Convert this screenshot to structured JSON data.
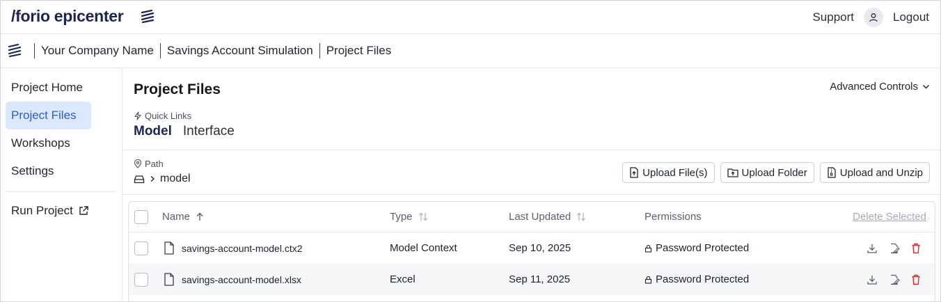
{
  "header": {
    "logo_slash": "/",
    "logo_forio": "forio",
    "logo_epicenter": "epicenter",
    "support": "Support",
    "logout": "Logout"
  },
  "breadcrumb": {
    "items": [
      "Your Company Name",
      "Savings Account Simulation",
      "Project Files"
    ]
  },
  "sidebar": {
    "items": [
      {
        "label": "Project Home",
        "active": false
      },
      {
        "label": "Project Files",
        "active": true
      },
      {
        "label": "Workshops",
        "active": false
      },
      {
        "label": "Settings",
        "active": false
      }
    ],
    "run_project": "Run Project"
  },
  "main": {
    "title": "Project Files",
    "advanced_controls": "Advanced Controls",
    "quick_links_label": "Quick Links",
    "quick_links": [
      "Model",
      "Interface"
    ],
    "path_label": "Path",
    "path_value": "model",
    "buttons": {
      "upload_files": "Upload File(s)",
      "upload_folder": "Upload Folder",
      "upload_unzip": "Upload and Unzip"
    }
  },
  "table": {
    "headers": {
      "name": "Name",
      "type": "Type",
      "updated": "Last Updated",
      "permissions": "Permissions",
      "delete_selected": "Delete Selected"
    },
    "rows": [
      {
        "name": "savings-account-model.ctx2",
        "type": "Model Context",
        "updated": "Sep 10, 2025",
        "permissions": "Password Protected"
      },
      {
        "name": "savings-account-model.xlsx",
        "type": "Excel",
        "updated": "Sep 11, 2025",
        "permissions": "Password Protected"
      }
    ]
  },
  "colors": {
    "brand_navy": "#1c2450",
    "active_nav_bg": "#dbe8fd",
    "active_nav_text": "#2a5fc4",
    "delete_red": "#e0262b"
  }
}
